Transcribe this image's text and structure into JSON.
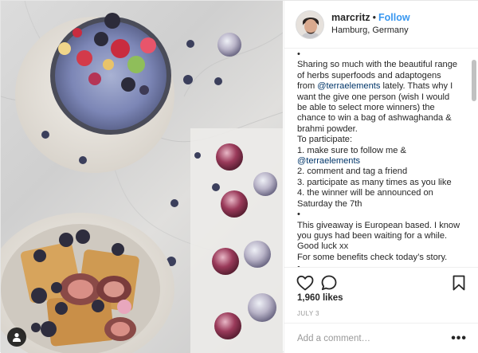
{
  "header": {
    "username": "marcritz",
    "separator": "•",
    "follow_label": "Follow",
    "location": "Hamburg, Germany"
  },
  "caption": {
    "lines": [
      "•",
      "Sharing so much with the beautiful range of herbs superfoods and adaptogens from",
      "@terraelements",
      "lately. Thats why I want the give one person (wish I would be able to select more winners) the chance to win a bag of ashwaghanda & brahmi powder.",
      "To participate:",
      "1. make sure to follow me &",
      "@terraelements",
      "2. comment and tag a friend",
      "3. participate as many times as you like",
      "4. the winner will be announced on Saturday the 7th",
      "•",
      "This giveaway is European based. I know you guys had been waiting for a while. Good luck xx",
      "For some benefits check today’s story.",
      "•"
    ]
  },
  "engagement": {
    "likes_text": "1,960 likes",
    "date_text": "JULY 3"
  },
  "comment": {
    "placeholder": "Add a comment…",
    "more_label": "•••"
  },
  "icons": {
    "like": "heart-icon",
    "comment": "comment-bubble-icon",
    "save": "bookmark-icon",
    "tag": "user-tag-icon"
  },
  "colors": {
    "accent": "#3897f0",
    "mention": "#003569",
    "muted": "#999999"
  }
}
